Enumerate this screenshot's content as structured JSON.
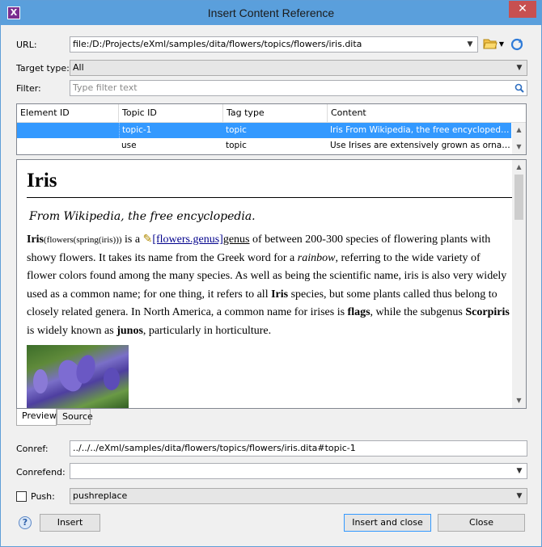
{
  "window": {
    "title": "Insert Content Reference",
    "app_icon": "oxygen-x-icon"
  },
  "url": {
    "label": "URL:",
    "value": "file:/D:/Projects/eXml/samples/dita/flowers/topics/flowers/iris.dita"
  },
  "target_type": {
    "label": "Target type:",
    "value": "All"
  },
  "filter": {
    "label": "Filter:",
    "placeholder": "Type filter text"
  },
  "table": {
    "columns": [
      "Element ID",
      "Topic ID",
      "Tag type",
      "Content"
    ],
    "rows": [
      {
        "element_id": "",
        "topic_id": "topic-1",
        "tag_type": "topic",
        "content": "Iris From Wikipedia, the free encyclopedia. Iris(flowers(spring(iris)))",
        "selected": true
      },
      {
        "element_id": "",
        "topic_id": "use",
        "tag_type": "topic",
        "content": "Use Irises are extensively grown as ornamental plants",
        "selected": false
      }
    ]
  },
  "preview": {
    "title": "Iris",
    "shortdesc": "From Wikipedia, the free encyclopedia.",
    "p_term": "Iris",
    "p_indexterms": "(flowers(spring(iris)))",
    "p_is_a": " is a ",
    "p_conref_link": "[flowers.genus]",
    "p_genus": "genus",
    "p_text1": " of between 200-300 species of flowering plants with showy flowers. It takes its name from the Greek word for a ",
    "p_rainbow": "rainbow",
    "p_text2": ", referring to the wide variety of flower colors found among the many species. As well as being the scientific name, iris is also very widely used as a common name; for one thing, it refers to all ",
    "p_iris2": "Iris",
    "p_text3": " species, but some plants called thus belong to closely related genera. In North America, a common name for irises is ",
    "p_flags": "flags",
    "p_text4": ", while the subgenus ",
    "p_scorpiris": "Scorpiris",
    "p_text5": " is widely known as ",
    "p_junos": "junos",
    "p_text6": ", particularly in horticulture."
  },
  "tabs": [
    {
      "label": "Preview",
      "active": true
    },
    {
      "label": "Source",
      "active": false
    }
  ],
  "conref": {
    "label": "Conref:",
    "value": "../../../eXml/samples/dita/flowers/topics/flowers/iris.dita#topic-1"
  },
  "conrefend": {
    "label": "Conrefend:",
    "value": ""
  },
  "push": {
    "label": "Push:",
    "value": "pushreplace",
    "checked": false
  },
  "buttons": {
    "insert": "Insert",
    "insert_close": "Insert and close",
    "close": "Close"
  },
  "colors": {
    "selection": "#3399ff",
    "titlebar": "#5a9fdc",
    "close": "#c75050"
  }
}
